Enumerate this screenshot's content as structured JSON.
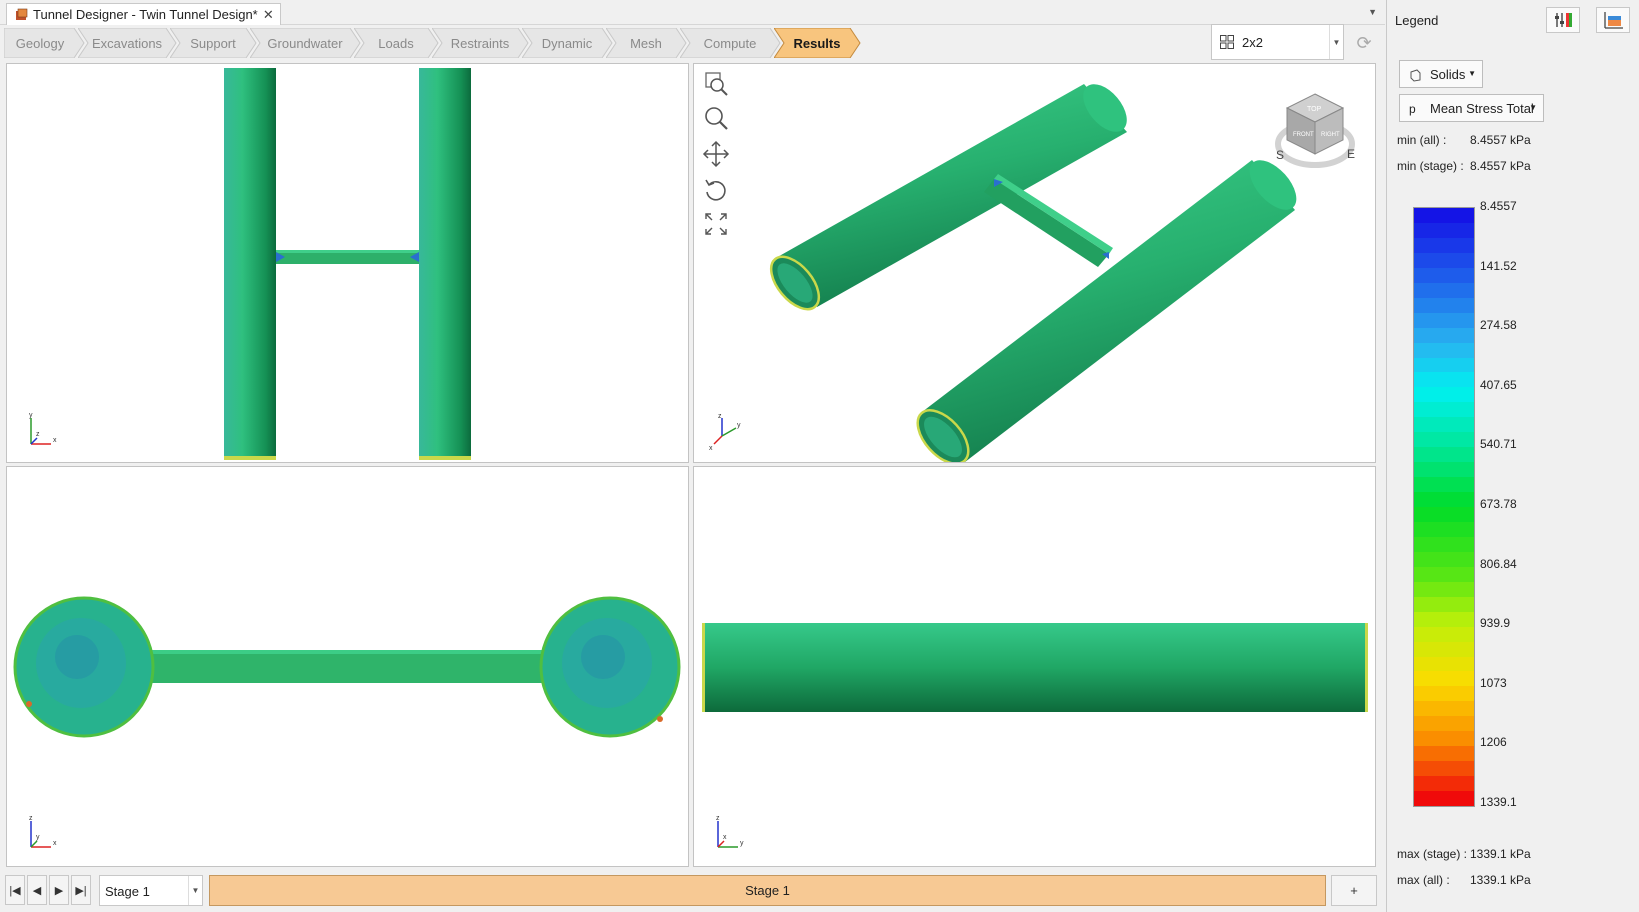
{
  "tab": {
    "title": "Tunnel Designer - Twin Tunnel Design*",
    "close": "✕"
  },
  "workflow": {
    "steps": [
      "Geology",
      "Excavations",
      "Support",
      "Groundwater",
      "Loads",
      "Restraints",
      "Dynamic",
      "Mesh",
      "Compute",
      "Results"
    ],
    "active": "Results"
  },
  "layout": {
    "value": "2x2"
  },
  "viewports": {
    "top_left": {
      "axis": [
        "y",
        "x",
        "z"
      ]
    },
    "top_right": {
      "axis": [
        "z",
        "x",
        "y"
      ],
      "viewcube": {
        "faces": [
          "TOP",
          "FRONT",
          "RIGHT"
        ],
        "compass": [
          "S",
          "E"
        ]
      }
    },
    "bottom_left": {
      "axis": [
        "z",
        "x",
        "y"
      ]
    },
    "bottom_right": {
      "axis": [
        "z",
        "y",
        "x"
      ]
    }
  },
  "stage": {
    "current": "Stage 1",
    "bar_label": "Stage 1",
    "add_label": "+"
  },
  "legend": {
    "title": "Legend",
    "entity_type": "Solids",
    "result_prefix": "p",
    "result_type": "Mean Stress Total",
    "min_all_label": "min (all) :",
    "min_all_value": "8.4557 kPa",
    "min_stage_label": "min (stage) :",
    "min_stage_value": "8.4557 kPa",
    "max_stage_label": "max (stage) :",
    "max_stage_value": "1339.1 kPa",
    "max_all_label": "max (all) :",
    "max_all_value": "1339.1 kPa",
    "ticks": [
      "8.4557",
      "141.52",
      "274.58",
      "407.65",
      "540.71",
      "673.78",
      "806.84",
      "939.9",
      "1073",
      "1206",
      "1339.1"
    ]
  },
  "colors": {
    "tunnel_dark": "#0f7a4a",
    "tunnel_mid": "#2fbf7a",
    "tunnel_light": "#3fcfa0",
    "stage_bar": "#f7c994",
    "active_step": "#f8c57e"
  }
}
